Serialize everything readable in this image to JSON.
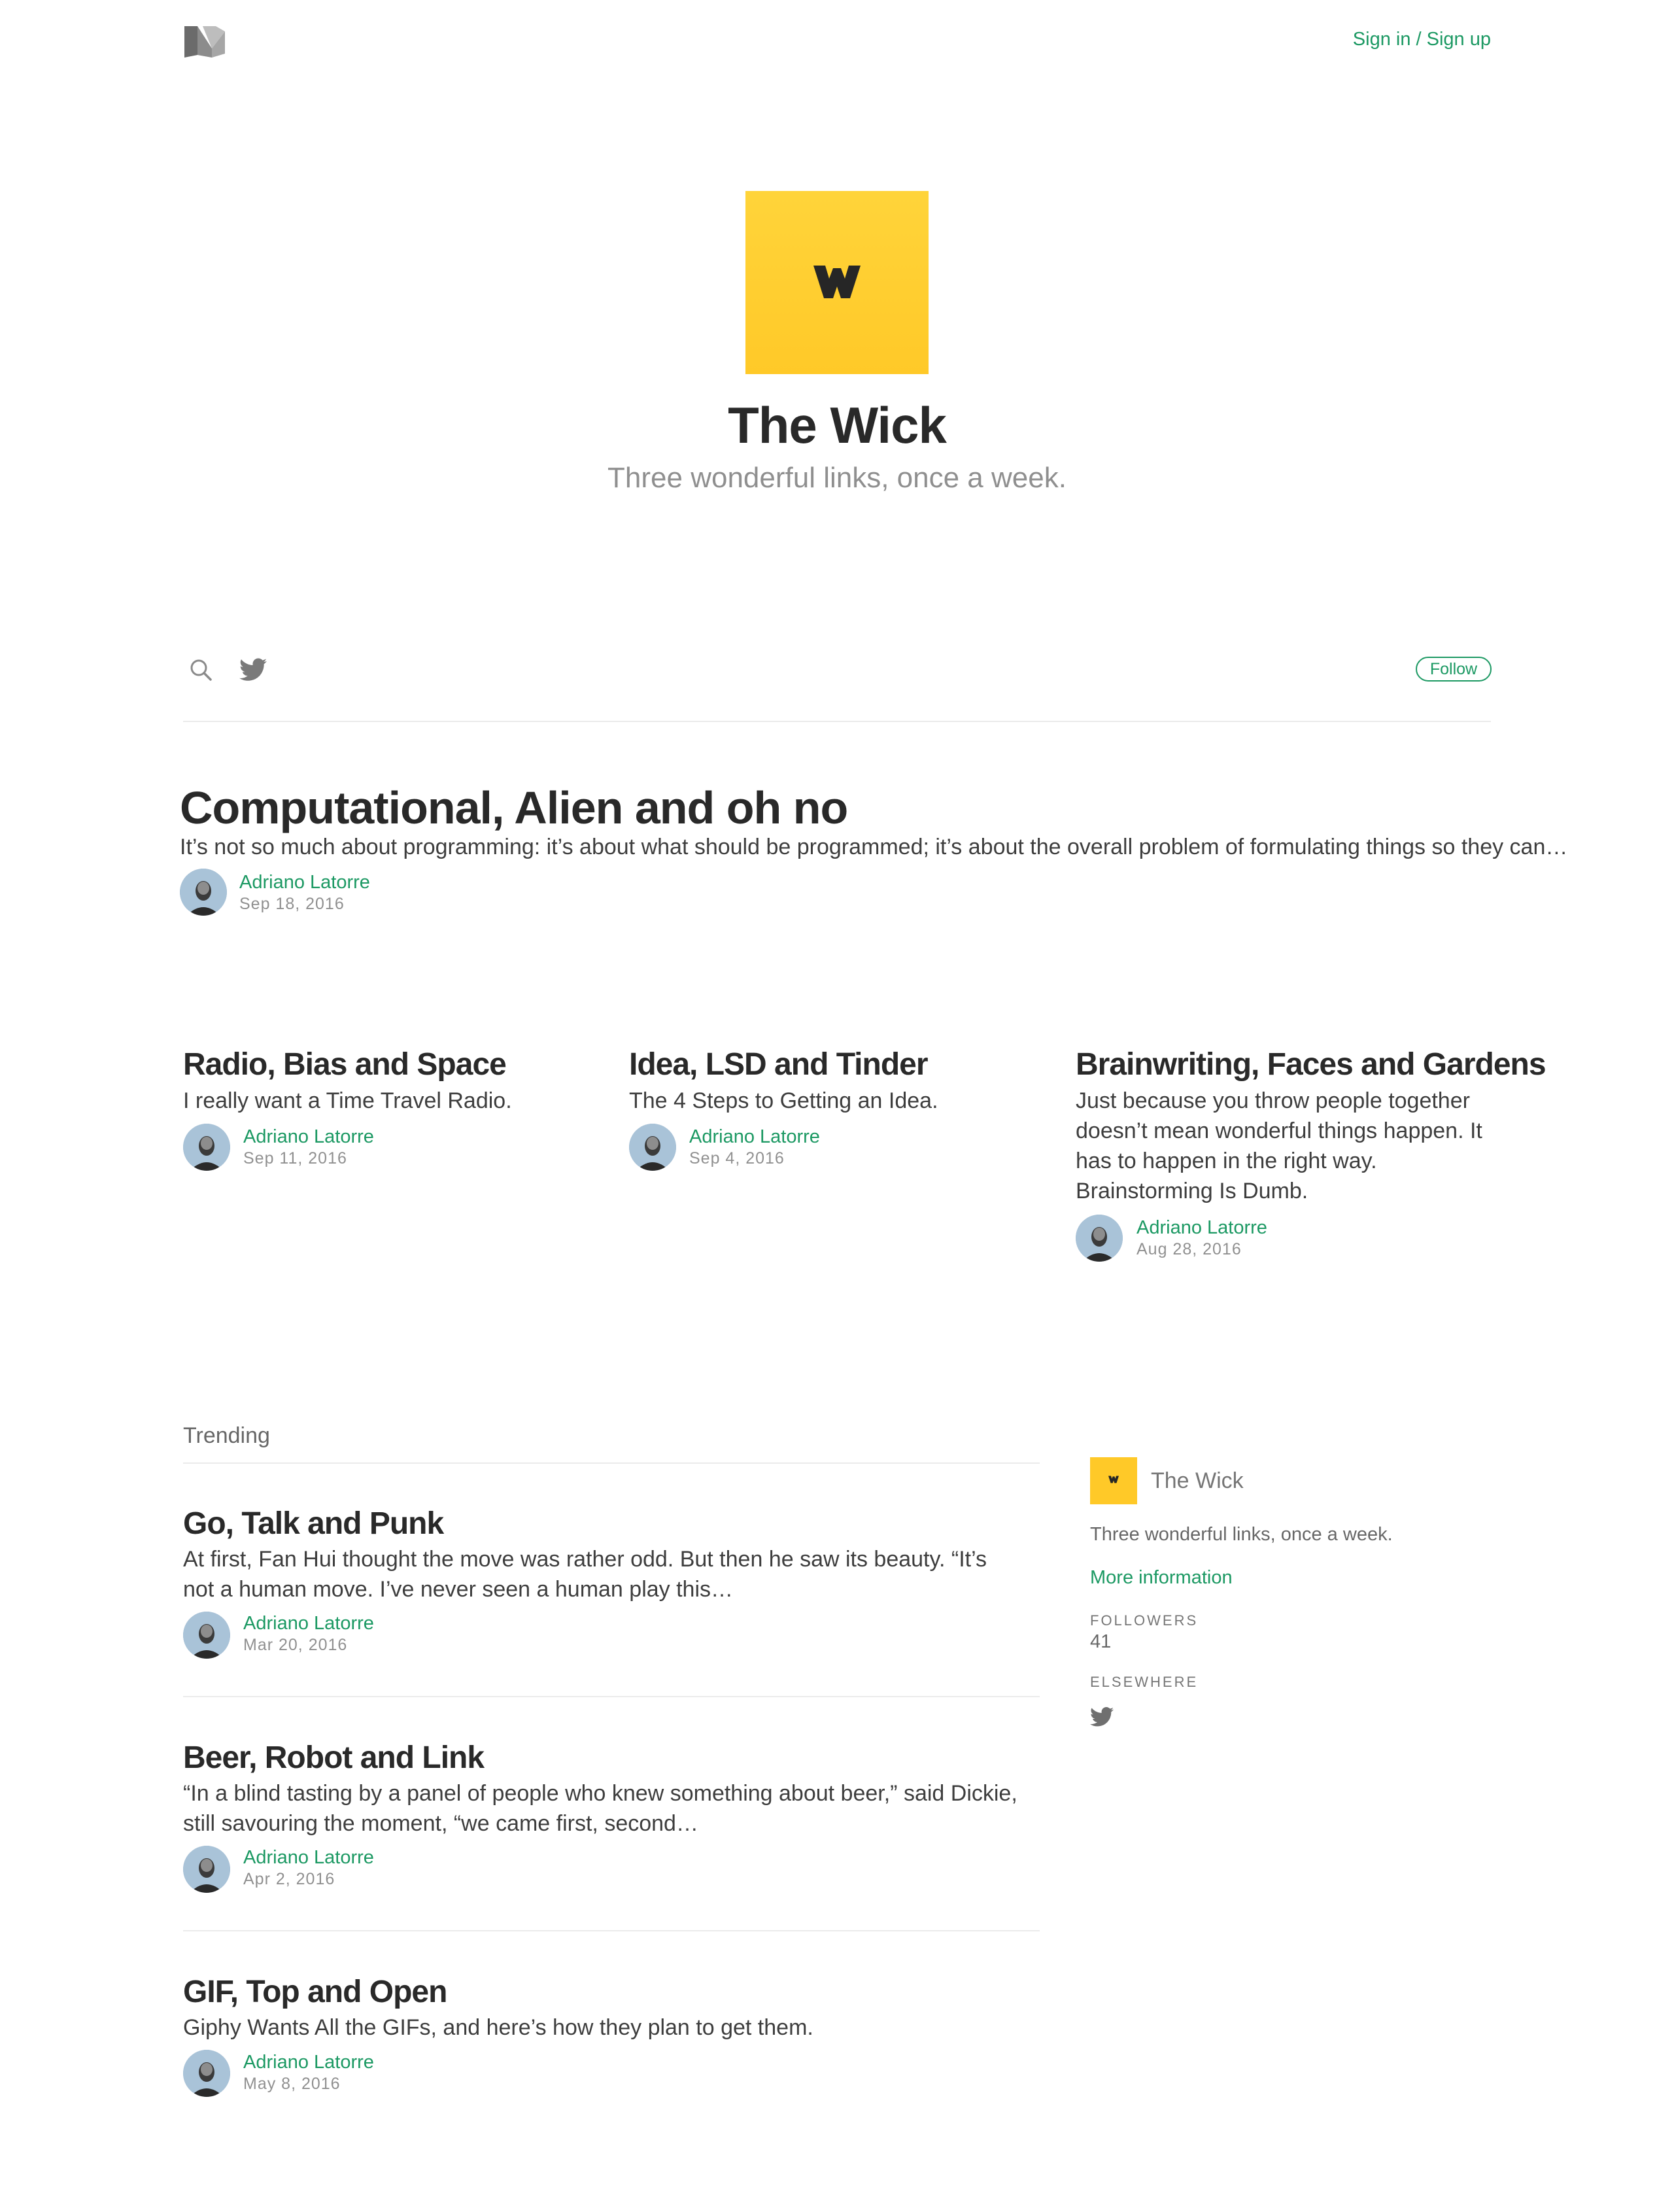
{
  "header": {
    "signin_label": "Sign in / Sign up"
  },
  "hero": {
    "title": "The Wick",
    "tagline": "Three wonderful links, once a week."
  },
  "nav": {
    "follow_label": "Follow"
  },
  "featured": {
    "title": "Computational, Alien and oh no",
    "subtitle": "It’s not so much about programming: it’s about what should be programmed; it’s about the overall problem of formulating things so they can…",
    "author": "Adriano Latorre",
    "date": "Sep 18, 2016"
  },
  "grid_posts": [
    {
      "title": "Radio, Bias and Space",
      "subtitle": "I really want a Time Travel Radio.",
      "author": "Adriano Latorre",
      "date": "Sep 11, 2016"
    },
    {
      "title": "Idea, LSD and Tinder",
      "subtitle": "The 4 Steps to Getting an Idea.",
      "author": "Adriano Latorre",
      "date": "Sep 4, 2016"
    },
    {
      "title": "Brainwriting, Faces and Gardens",
      "subtitle": "Just because you throw people together doesn’t mean wonderful things happen. It has to happen in the right way. Brainstorming Is Dumb.",
      "author": "Adriano Latorre",
      "date": "Aug 28, 2016"
    }
  ],
  "trending": {
    "label": "Trending",
    "posts": [
      {
        "title": "Go, Talk and Punk",
        "subtitle": "At first, Fan Hui thought the move was rather odd. But then he saw its beauty. “It’s not a human move. I’ve never seen a human play this…",
        "author": "Adriano Latorre",
        "date": "Mar 20, 2016"
      },
      {
        "title": "Beer, Robot and Link",
        "subtitle": "“In a blind tasting by a panel of people who knew something about beer,” said Dickie, still savouring the moment, “we came first, second…",
        "author": "Adriano Latorre",
        "date": "Apr 2, 2016"
      },
      {
        "title": "GIF, Top and Open",
        "subtitle": "Giphy Wants All the GIFs, and here’s how they plan to get them.",
        "author": "Adriano Latorre",
        "date": "May 8, 2016"
      }
    ]
  },
  "sidebar": {
    "name": "The Wick",
    "description": "Three wonderful links, once a week.",
    "more_info": "More information",
    "followers_label": "FOLLOWERS",
    "followers_count": "41",
    "elsewhere_label": "ELSEWHERE"
  },
  "colors": {
    "accent": "#1c9963",
    "brand_yellow": "#ffc928"
  },
  "icons": [
    "medium-logo-icon",
    "wick-logo-icon",
    "search-icon",
    "twitter-icon"
  ]
}
